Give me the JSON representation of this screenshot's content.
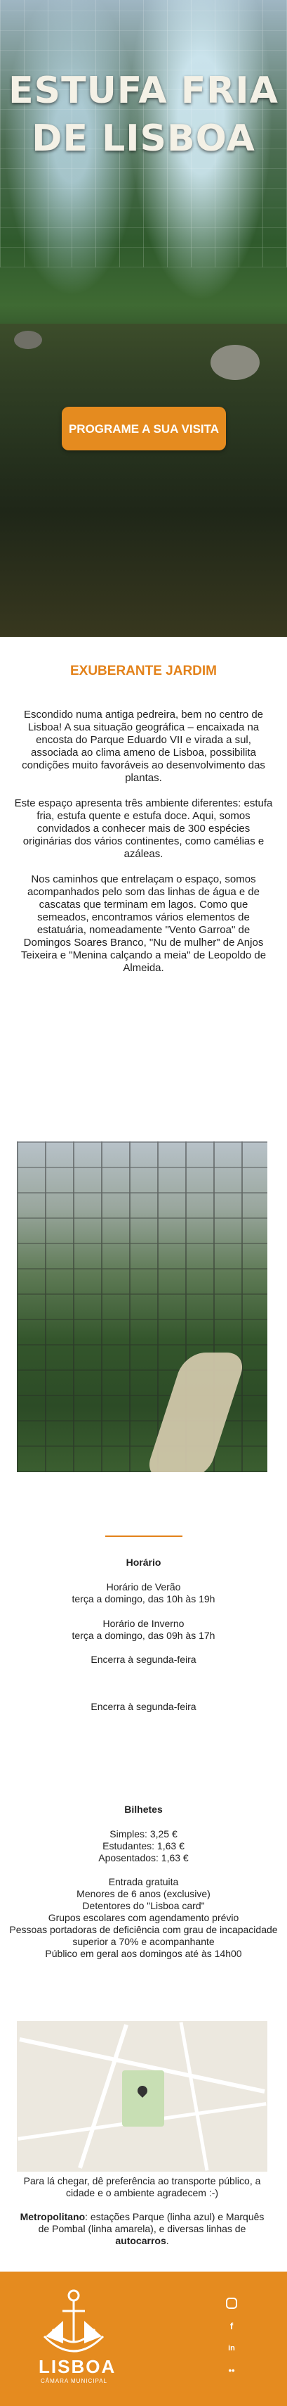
{
  "hero": {
    "title_line1": "ESTUFA FRIA",
    "title_line2": "DE LISBOA",
    "cta_label": "PROGRAME A SUA VISITA"
  },
  "intro": {
    "heading": "EXUBERANTE JARDIM",
    "paragraphs": [
      "Escondido numa antiga pedreira, bem no centro de Lisboa! A sua situação geográfica – encaixada na encosta do Parque Eduardo VII e virada a sul, associada ao clima ameno de Lisboa, possibilita condições muito favoráveis ao desenvolvimento das plantas.",
      "Este espaço apresenta três ambiente diferentes: estufa fria, estufa quente e estufa doce. Aqui, somos convidados a conhecer mais de 300 espécies originárias dos vários continentes, como camélias e azáleas.",
      "Nos caminhos que entrelaçam o espaço, somos acompanhados pelo som das linhas de água e de cascatas que terminam em lagos. Como que semeados, encontramos vários elementos de estatuária, nomeadamente \"Vento Garroa\" de Domingos Soares Branco, \"Nu de mulher\" de Anjos Teixeira e \"Menina calçando a meia\" de Leopoldo de Almeida."
    ]
  },
  "schedule": {
    "heading": "Horário",
    "summer_label": "Horário de Verão",
    "summer_hours": "terça a domingo, das 10h às 19h",
    "winter_label": "Horário de Inverno",
    "winter_hours": "terça a domingo, das 09h às 17h",
    "closed_1": "Encerra à segunda-feira",
    "closed_2": "Encerra à segunda-feira"
  },
  "tickets": {
    "heading": "Bilhetes",
    "simples": "Simples: 3,25 €",
    "estudantes": "Estudantes: 1,63 €",
    "aposentados": "Aposentados: 1,63 €",
    "free_heading": "Entrada gratuita",
    "free_items": [
      "Menores de 6 anos (exclusive)",
      "Detentores do \"Lisboa card\"",
      "Grupos escolares com agendamento prévio",
      "Pessoas portadoras de deficiência com grau de incapacidade superior a 70% e acompanhante",
      "Público em geral aos domingos até às 14h00"
    ]
  },
  "directions": {
    "intro": "Para lá chegar, dê preferência ao transporte público, a cidade e o ambiente agradecem :-)",
    "metro_label": "Metropolitano",
    "metro_text": ": estações Parque (linha azul) e Marquês de Pombal (linha amarela), e diversas linhas de ",
    "bus_label": "autocarros",
    "end": "."
  },
  "footer": {
    "brand": "LISBOA",
    "sub": "CÂMARA MUNICIPAL",
    "social_icons": [
      "instagram-icon",
      "facebook-icon",
      "linkedin-icon",
      "flickr-icon"
    ]
  },
  "colors": {
    "accent": "#e58b1f",
    "heading": "#e3821a"
  }
}
